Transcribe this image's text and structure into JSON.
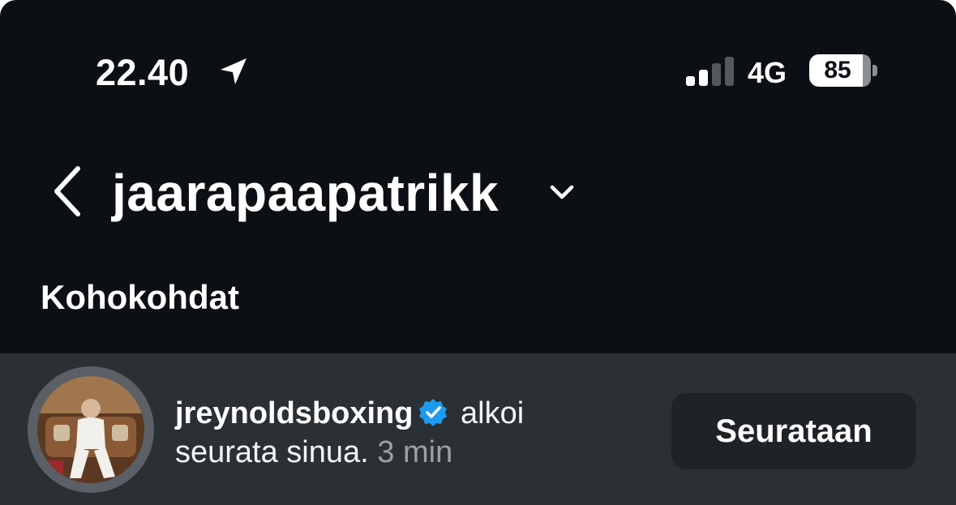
{
  "status_bar": {
    "time": "22.40",
    "network": "4G",
    "battery": "85",
    "icons": [
      "location-arrow-icon",
      "signal-bars-icon",
      "battery-icon"
    ]
  },
  "header": {
    "username": "jaarapaapatrikk",
    "icons": [
      "back-arrow-icon",
      "chevron-down-icon"
    ]
  },
  "section": {
    "title": "Kohokohdat"
  },
  "notification": {
    "username": "jreynoldsboxing",
    "action_text": "alkoi seurata sinua.",
    "time": "3 min",
    "button_label": "Seurataan",
    "verified": true,
    "colors": {
      "verified_blue": "#1d9bf0",
      "row_background": "#2b3034",
      "button_background": "#1f2327"
    }
  },
  "colors": {
    "background": "#0c1014",
    "text": "#ffffff",
    "muted_text": "#9aa0a6"
  }
}
